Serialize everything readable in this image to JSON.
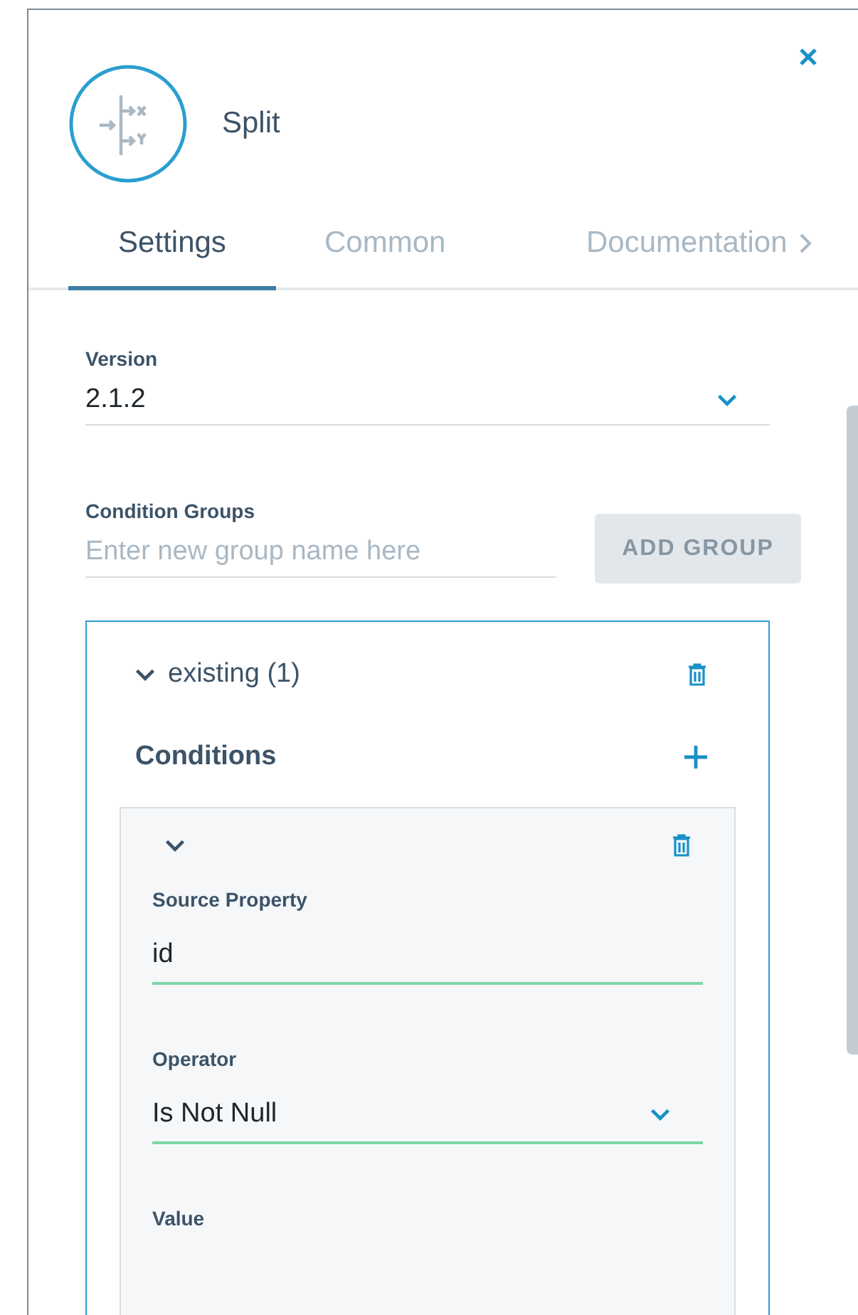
{
  "header": {
    "title": "Split"
  },
  "tabs": [
    {
      "label": "Settings",
      "selected": true
    },
    {
      "label": "Common",
      "selected": false
    },
    {
      "label": "Documentation",
      "selected": false
    }
  ],
  "version": {
    "label": "Version",
    "value": "2.1.2"
  },
  "condition_groups": {
    "label": "Condition Groups",
    "placeholder": "Enter new group name here",
    "button": {
      "label": "ADD GROUP",
      "disabled": true
    }
  },
  "groups": [
    {
      "name": "existing (1)",
      "expanded": true,
      "conditions_label": "Conditions",
      "conditions": [
        {
          "expanded": true,
          "fields": [
            {
              "kind": "text",
              "label": "Source Property",
              "value": "id"
            },
            {
              "kind": "select",
              "label": "Operator",
              "value": "Is Not Null"
            },
            {
              "kind": "text",
              "label": "Value"
            }
          ]
        }
      ]
    }
  ]
}
